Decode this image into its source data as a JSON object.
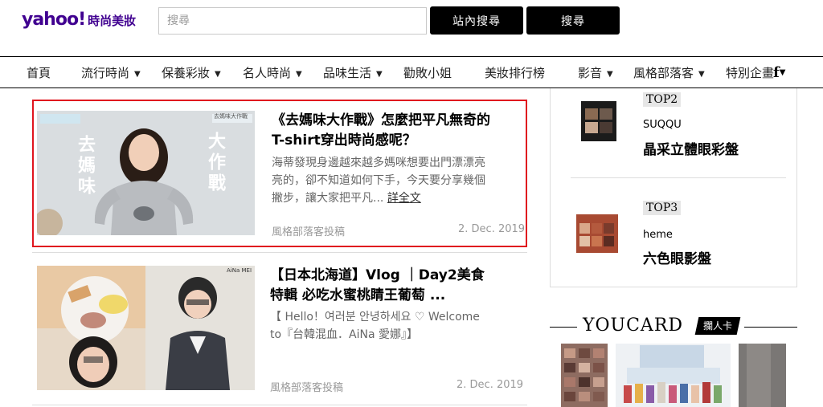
{
  "header": {
    "logo_word": "yahoo!",
    "logo_section": "時尚美妝",
    "search_placeholder": "搜尋",
    "site_search_label": "站內搜尋",
    "web_search_label": "搜尋"
  },
  "nav": {
    "items": [
      {
        "label": "首頁",
        "caret": ""
      },
      {
        "label": "流行時尚",
        "caret": "▼"
      },
      {
        "label": "保養彩妝",
        "caret": "▼"
      },
      {
        "label": "名人時尚",
        "caret": "▼"
      },
      {
        "label": "品味生活",
        "caret": "▼"
      },
      {
        "label": "勸敗小姐",
        "caret": ""
      },
      {
        "label": "美妝排行榜",
        "caret": ""
      },
      {
        "label": "影音",
        "caret": "▼"
      },
      {
        "label": "風格部落客",
        "caret": "▼"
      },
      {
        "label": "特別企畫",
        "caret": ""
      }
    ],
    "fb_label": "f",
    "fb_caret": "▼"
  },
  "articles": [
    {
      "title": "《去媽味大作戰》怎麼把平凡無奇的T-shirt穿出時尚感呢？",
      "summary": "海蒂發現身邊越來越多媽咪想要出門漂漂亮亮的，卻不知道如何下手，今天要分享幾個撇步，讓大家把平凡...",
      "more": "詳全文",
      "source": "風格部落客投稿",
      "date": "2. Dec. 2019",
      "thumb_text": {
        "left": "去媽味",
        "right": "大作戰",
        "tag": "去媽味大作戰"
      }
    },
    {
      "title": "【日本北海道】Vlog ｜Day2美食特輯 必吃水蜜桃睛王葡萄 ...",
      "summary": "【 Hello！여러분 안녕하세요 ♡ Welcome to『台韓混血．AiNa 愛娜』】",
      "source": "風格部落客投稿",
      "date": "2. Dec. 2019",
      "thumb_text": {
        "tag": "AiNa MEI"
      }
    }
  ],
  "ranking": [
    {
      "rank": "TOP2",
      "brand": "SUQQU",
      "name": "晶采立體眼彩盤"
    },
    {
      "rank": "TOP3",
      "brand": "heme",
      "name": "六色眼影盤"
    }
  ],
  "youcard": {
    "title": "YOUCARD",
    "tag": "攔人卡"
  },
  "colors": {
    "brand": "#400090",
    "highlight_border": "#e0141e",
    "button_bg": "#000000"
  }
}
